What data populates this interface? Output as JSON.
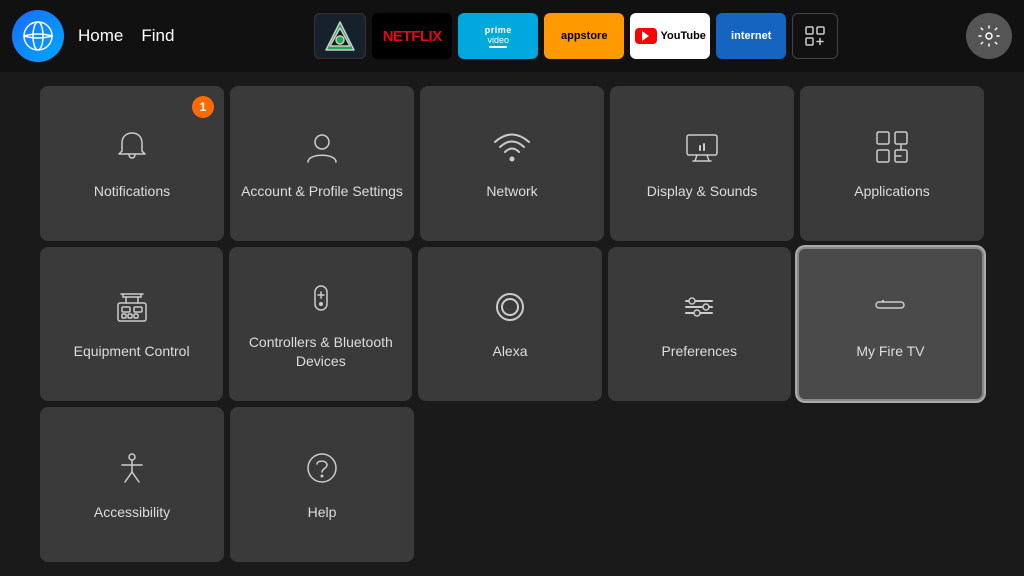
{
  "nav": {
    "home_label": "Home",
    "find_label": "Find",
    "apps": [
      {
        "id": "kodi",
        "label": "Kodi"
      },
      {
        "id": "netflix",
        "label": "NETFLIX"
      },
      {
        "id": "prime",
        "label": "prime video"
      },
      {
        "id": "appstore",
        "label": "appstore"
      },
      {
        "id": "youtube",
        "label": "YouTube"
      },
      {
        "id": "internet",
        "label": "internet"
      },
      {
        "id": "grid",
        "label": "Grid"
      }
    ]
  },
  "tiles": {
    "row1": [
      {
        "id": "notifications",
        "label": "Notifications",
        "badge": "1"
      },
      {
        "id": "account",
        "label": "Account & Profile Settings",
        "badge": null
      },
      {
        "id": "network",
        "label": "Network",
        "badge": null
      },
      {
        "id": "display",
        "label": "Display & Sounds",
        "badge": null
      },
      {
        "id": "applications",
        "label": "Applications",
        "badge": null
      }
    ],
    "row2": [
      {
        "id": "equipment",
        "label": "Equipment Control",
        "badge": null
      },
      {
        "id": "controllers",
        "label": "Controllers & Bluetooth Devices",
        "badge": null
      },
      {
        "id": "alexa",
        "label": "Alexa",
        "badge": null
      },
      {
        "id": "preferences",
        "label": "Preferences",
        "badge": null
      },
      {
        "id": "myfiretv",
        "label": "My Fire TV",
        "badge": null,
        "focused": true
      }
    ],
    "row3": [
      {
        "id": "accessibility",
        "label": "Accessibility",
        "badge": null
      },
      {
        "id": "help",
        "label": "Help",
        "badge": null
      }
    ]
  },
  "colors": {
    "badge_bg": "#FF6B00",
    "tile_bg": "#3a3a3a",
    "focused_border": "#888888",
    "nav_bg": "#111111",
    "body_bg": "#1a1a1a"
  }
}
